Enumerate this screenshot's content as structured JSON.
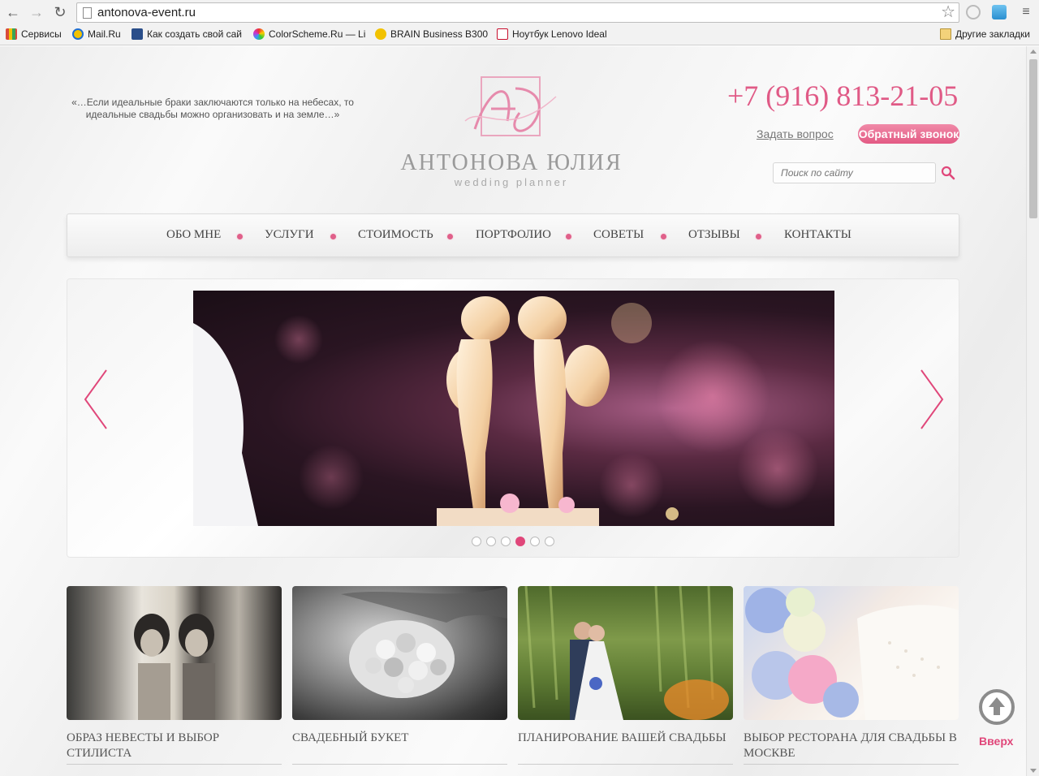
{
  "browser": {
    "url": "antonova-event.ru",
    "bookmarks": [
      {
        "label": "Сервисы",
        "icon": "apps-grid-icon",
        "color": "#d94a3a"
      },
      {
        "label": "Mail.Ru",
        "icon": "mailru-icon",
        "color": "#1e6ed2"
      },
      {
        "label": "Как создать свой сай",
        "icon": "site-icon",
        "color": "#2a4e8a"
      },
      {
        "label": "ColorScheme.Ru — Li",
        "icon": "colorwheel-icon",
        "color": "#7ab83a"
      },
      {
        "label": "BRAIN Business B300",
        "icon": "brain-icon",
        "color": "#f2c200"
      },
      {
        "label": "Ноутбук Lenovo Ideal",
        "icon": "lenovo-icon",
        "color": "#c8102e"
      }
    ],
    "other_bookmarks": "Другие закладки"
  },
  "header": {
    "quote": "«…Если идеальные браки заключаются только на небесах, то идеальные свадьбы можно организовать и на земле…»",
    "logo_name": "АНТОНОВА ЮЛИЯ",
    "logo_sub": "wedding planner",
    "phone": "+7 (916) 813-21-05",
    "ask_link": "Задать вопрос",
    "callback": "Обратный звонок",
    "search_placeholder": "Поиск по сайту"
  },
  "menu": [
    "ОБО МНЕ",
    "УСЛУГИ",
    "СТОИМОСТЬ",
    "ПОРТФОЛИО",
    "СОВЕТЫ",
    "ОТЗЫВЫ",
    "КОНТАКТЫ"
  ],
  "slider": {
    "total": 6,
    "active": 4
  },
  "cards": [
    {
      "title": "ОБРАЗ НЕВЕСТЫ И ВЫБОР СТИЛИСТА"
    },
    {
      "title": "СВАДЕБНЫЙ БУКЕТ"
    },
    {
      "title": "ПЛАНИРОВАНИЕ ВАШЕЙ СВАДЬБЫ"
    },
    {
      "title": "ВЫБОР РЕСТОРАНА ДЛЯ СВАДЬБЫ В МОСКВЕ"
    }
  ],
  "up_label": "Вверх",
  "colors": {
    "accent": "#e0477a",
    "menu_dot": "#e0608a",
    "text": "#555555"
  }
}
